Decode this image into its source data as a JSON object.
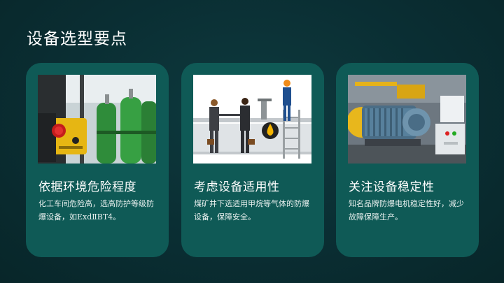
{
  "slide": {
    "title": "设备选型要点"
  },
  "cards": [
    {
      "title": "依据环境危险程度",
      "desc": "化工车间危险高，选高防护等级防爆设备，如ExdⅡBT4。",
      "image_icon": "gas-cylinder-switch-photo"
    },
    {
      "title": "考虑设备适用性",
      "desc": "煤矿井下选适用甲烷等气体的防爆设备，保障安全。",
      "image_icon": "business-handshake-pipeline-illustration"
    },
    {
      "title": "关注设备稳定性",
      "desc": "知名品牌防爆电机稳定性好，减少故障保障生产。",
      "image_icon": "explosion-proof-motor-photo"
    }
  ],
  "colors": {
    "background": "#0a2e33",
    "card": "#0f5a56",
    "text": "#ffffff"
  }
}
